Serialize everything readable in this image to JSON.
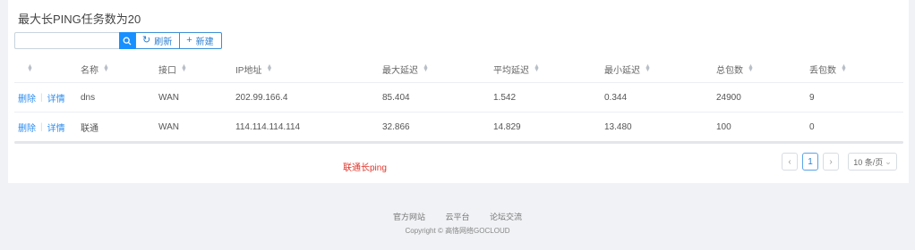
{
  "page_title": "最大长PING任务数为20",
  "search": {
    "placeholder": "",
    "value": ""
  },
  "toolbar": {
    "refresh_label": "刷新",
    "new_label": "新建",
    "refresh_icon": "refresh-icon",
    "new_icon": "plus-icon"
  },
  "table": {
    "headers": [
      "",
      "名称",
      "接口",
      "IP地址",
      "最大延迟",
      "平均延迟",
      "最小延迟",
      "总包数",
      "丢包数"
    ],
    "rows": [
      {
        "delete": "删除",
        "details": "详情",
        "name": "dns",
        "interface": "WAN",
        "ip": "202.99.166.4",
        "max_latency": "85.404",
        "avg_latency": "1.542",
        "min_latency": "0.344",
        "total_packets": "24900",
        "lost_packets": "9"
      },
      {
        "delete": "删除",
        "details": "详情",
        "name": "联通",
        "interface": "WAN",
        "ip": "114.114.114.114",
        "max_latency": "32.866",
        "avg_latency": "14.829",
        "min_latency": "13.480",
        "total_packets": "100",
        "lost_packets": "0"
      }
    ]
  },
  "caption": "联通长ping",
  "pagination": {
    "prev": "‹",
    "current_page": "1",
    "next": "›",
    "page_size": "10 条/页"
  },
  "footer": {
    "links": [
      "官方网站",
      "云平台",
      "论坛交流"
    ],
    "copyright": "Copyright © 高恪网络GOCLOUD"
  },
  "colors": {
    "accent": "#1890ff",
    "caption": "#e0352b"
  }
}
